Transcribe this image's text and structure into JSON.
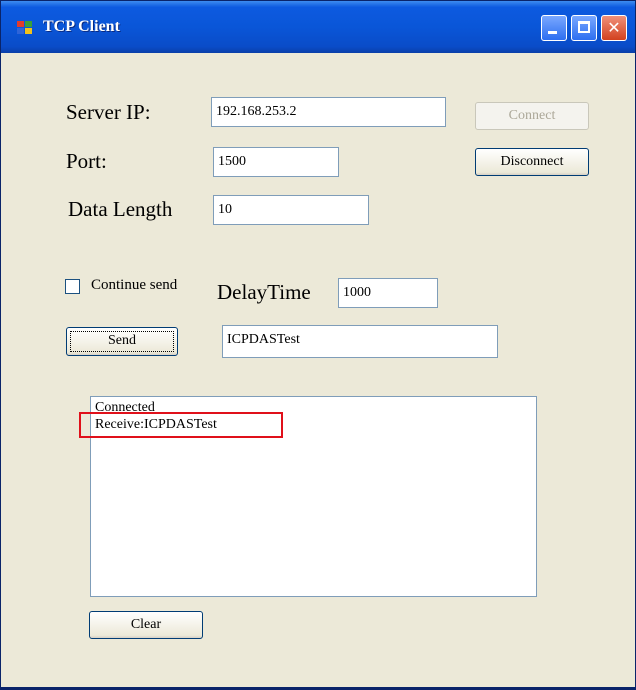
{
  "window": {
    "title": "TCP Client"
  },
  "titlebar": {
    "minimize_icon": "minimize-icon",
    "maximize_icon": "maximize-icon",
    "close_icon": "close-icon",
    "close_glyph": "✕"
  },
  "form": {
    "server_ip_label": "Server IP:",
    "server_ip_value": "192.168.253.2",
    "port_label": "Port:",
    "port_value": "1500",
    "data_length_label": "Data Length",
    "data_length_value": "10",
    "continue_send_label": "Continue send",
    "continue_send_checked": false,
    "delay_time_label": "DelayTime",
    "delay_time_value": "1000",
    "send_text_value": "ICPDASTest"
  },
  "buttons": {
    "connect": "Connect",
    "disconnect": "Disconnect",
    "send": "Send",
    "clear": "Clear"
  },
  "log": {
    "lines": [
      "Connected",
      "Receive:ICPDASTest"
    ]
  },
  "colors": {
    "titlebar": "#0a56d8",
    "window_bg": "#ece9d8",
    "highlight_border": "#e0101a"
  }
}
